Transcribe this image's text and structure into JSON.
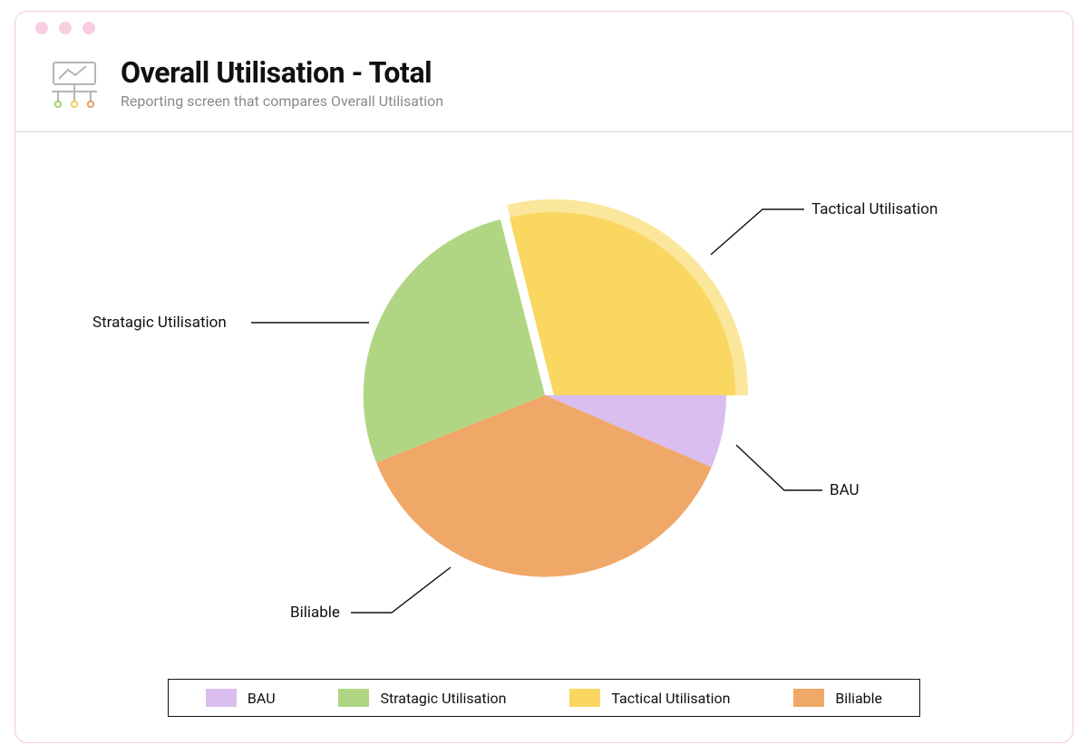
{
  "header": {
    "title": "Overall Utilisation - Total",
    "subtitle": "Reporting screen that compares Overall Utilisation"
  },
  "callouts": {
    "tactical": "Tactical Utilisation",
    "bau": "BAU",
    "biliable": "Biliable",
    "stratagic": "Stratagic Utilisation"
  },
  "legend": [
    {
      "label": "BAU",
      "color": "#d9beef"
    },
    {
      "label": "Stratagic Utilisation",
      "color": "#b0d683"
    },
    {
      "label": "Tactical Utilisation",
      "color": "#f9d761"
    },
    {
      "label": "Biliable",
      "color": "#f0a868"
    }
  ],
  "colors": {
    "bau": "#d9beef",
    "stratagic": "#b0d683",
    "tactical": "#f9d761",
    "tactical_outer": "#fbe79b",
    "biliable": "#f0a868"
  },
  "chart_data": {
    "type": "pie",
    "title": "Overall Utilisation - Total",
    "series": [
      {
        "name": "Tactical Utilisation",
        "value": 33,
        "color": "#f9d761",
        "exploded": true
      },
      {
        "name": "BAU",
        "value": 8,
        "color": "#d9beef"
      },
      {
        "name": "Biliable",
        "value": 34,
        "color": "#f0a868"
      },
      {
        "name": "Stratagic Utilisation",
        "value": 25,
        "color": "#b0d683"
      }
    ],
    "legend_position": "bottom"
  }
}
